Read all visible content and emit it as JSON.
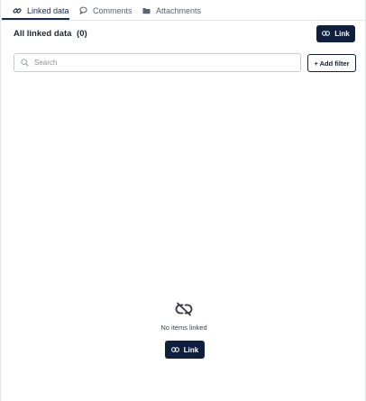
{
  "tabs": [
    {
      "label": "Linked data",
      "icon": "link-icon",
      "active": true
    },
    {
      "label": "Comments",
      "icon": "comment-icon",
      "active": false
    },
    {
      "label": "Attachments",
      "icon": "folder-icon",
      "active": false
    }
  ],
  "header": {
    "title": "All linked data",
    "count": "(0)",
    "link_button_label": "Link"
  },
  "search": {
    "placeholder": "Search",
    "value": ""
  },
  "filter": {
    "add_filter_label": "+ Add filter"
  },
  "empty_state": {
    "icon": "unlink-icon",
    "message": "No items linked",
    "link_button_label": "Link"
  },
  "colors": {
    "primary": "#0f1f3d",
    "tab_active": "#1c2a4a",
    "border": "#c7ccd4"
  }
}
